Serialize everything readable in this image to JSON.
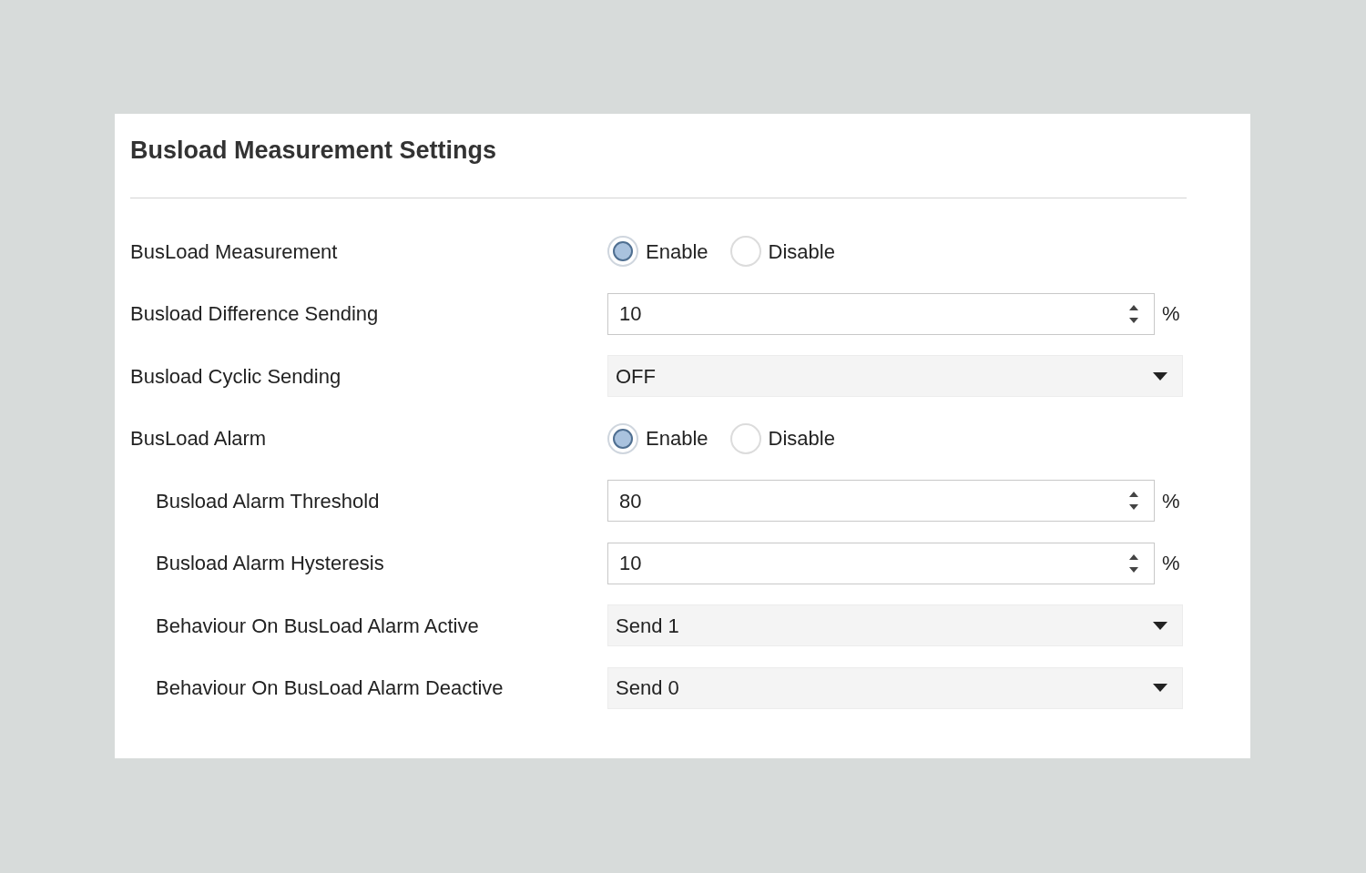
{
  "panel": {
    "title": "Busload Measurement Settings"
  },
  "rows": [
    {
      "label": "BusLoad Measurement",
      "kind": "radio",
      "options": [
        {
          "label": "Enable",
          "selected": true
        },
        {
          "label": "Disable",
          "selected": false
        }
      ]
    },
    {
      "label": "Busload Difference Sending",
      "kind": "spin",
      "value": "10",
      "unit": "%"
    },
    {
      "label": "Busload Cyclic Sending",
      "kind": "select",
      "value": "OFF"
    },
    {
      "label": "BusLoad Alarm",
      "kind": "radio",
      "options": [
        {
          "label": "Enable",
          "selected": true
        },
        {
          "label": "Disable",
          "selected": false
        }
      ],
      "children": [
        {
          "label": "Busload Alarm Threshold",
          "kind": "spin",
          "value": "80",
          "unit": "%"
        },
        {
          "label": "Busload Alarm Hysteresis",
          "kind": "spin",
          "value": "10",
          "unit": "%"
        },
        {
          "label": "Behaviour On BusLoad Alarm Active",
          "kind": "select",
          "value": "Send 1"
        },
        {
          "label": "Behaviour On BusLoad Alarm Deactive",
          "kind": "select",
          "value": "Send 0"
        }
      ]
    }
  ]
}
